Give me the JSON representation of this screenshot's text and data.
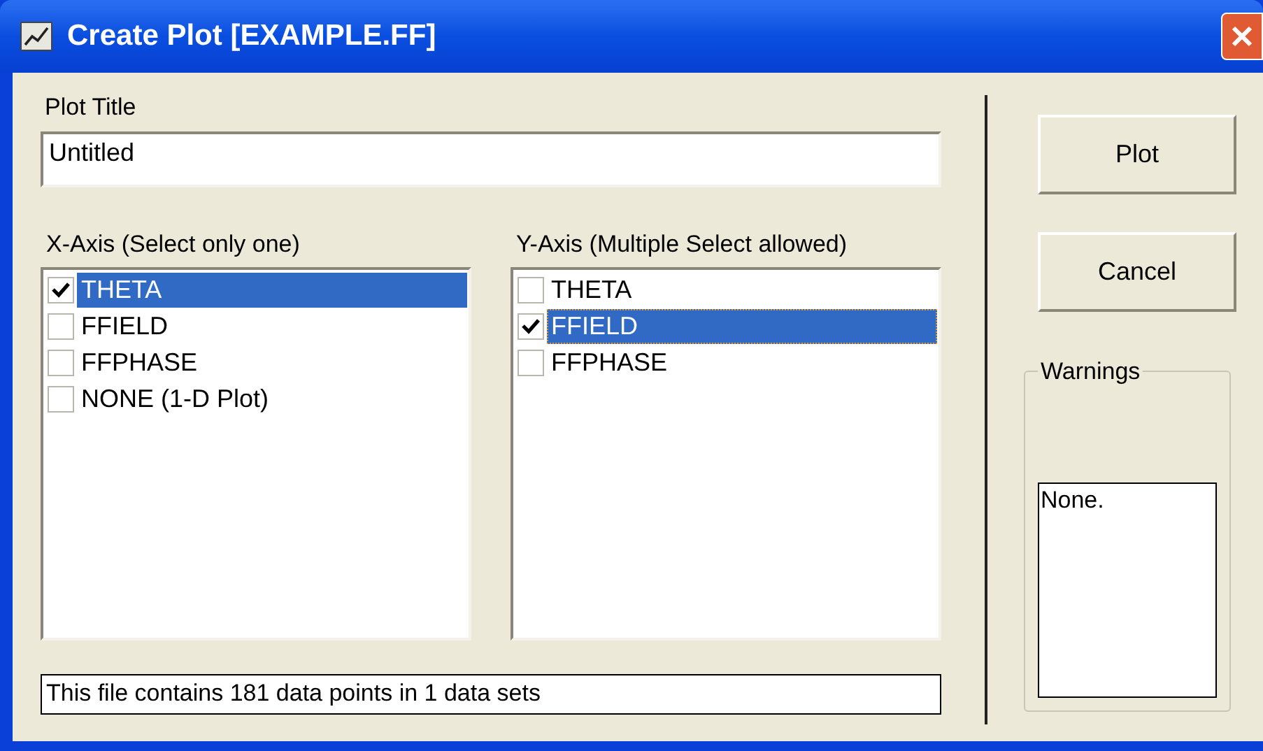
{
  "window": {
    "title": "Create Plot [EXAMPLE.FF]"
  },
  "plot_title": {
    "label": "Plot Title",
    "value": "Untitled"
  },
  "x_axis": {
    "label": "X-Axis (Select only one)",
    "items": [
      {
        "label": "THETA",
        "checked": true,
        "selected": true,
        "focused": false
      },
      {
        "label": "FFIELD",
        "checked": false,
        "selected": false,
        "focused": false
      },
      {
        "label": "FFPHASE",
        "checked": false,
        "selected": false,
        "focused": false
      },
      {
        "label": "NONE (1-D Plot)",
        "checked": false,
        "selected": false,
        "focused": false
      }
    ]
  },
  "y_axis": {
    "label": "Y-Axis (Multiple Select allowed)",
    "items": [
      {
        "label": "THETA",
        "checked": false,
        "selected": false,
        "focused": false
      },
      {
        "label": "FFIELD",
        "checked": true,
        "selected": true,
        "focused": true
      },
      {
        "label": "FFPHASE",
        "checked": false,
        "selected": false,
        "focused": false
      }
    ]
  },
  "status": "This file contains 181 data points in 1 data sets",
  "buttons": [
    "Plot",
    "Cancel"
  ],
  "warnings": {
    "label": "Warnings",
    "text": "None."
  }
}
